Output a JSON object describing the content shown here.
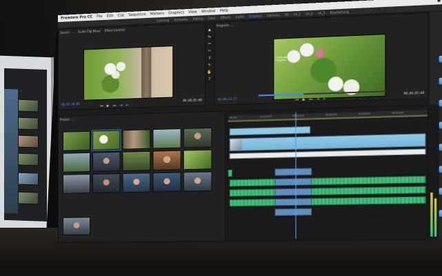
{
  "scene": "photo of an iMac displaying a video editing application",
  "colors": {
    "accent_blue": "#3c8dff",
    "video_clip": "#8fc9e8",
    "audio_clip": "#3fbf7a",
    "selected_audio": "#5f8fc0",
    "ui_dark": "#1d1d1d"
  },
  "menubar": {
    "app_name": "Premiere Pro CC",
    "items": [
      "File",
      "Edit",
      "Clip",
      "Sequence",
      "Markers",
      "Graphics",
      "View",
      "Window",
      "Help"
    ],
    "status": "● ● ● ●"
  },
  "workspaces": {
    "items": [
      "Learning",
      "Assembly",
      "Editing",
      "Color",
      "Effects",
      "Audio",
      "Graphics",
      "Libraries",
      "All",
      "ch_1",
      "ch_2",
      "ch_3",
      "Bearbeitung"
    ],
    "active_index": 6
  },
  "source_monitor": {
    "tabs": [
      "Source: ...",
      "Audio Clip Mixer",
      "Effect Controls"
    ],
    "timecode_in": "00;00;00;00",
    "timecode_out": "00;00;05;00"
  },
  "program_monitor": {
    "tabs": [
      "Program: ..."
    ],
    "timecode_in": "00;00;42;17",
    "timecode_out": "00;00;05;00",
    "overlay_label": "Laufende Projekte"
  },
  "project_panel": {
    "title": "Project: ...",
    "clip_count": 15
  },
  "timeline": {
    "ruler_labels": [
      "00;00",
      "00;02;00",
      "00;04;00",
      "00;06;00",
      "00;08;00",
      "00;10;00"
    ]
  },
  "icons": {
    "transport": [
      "step-back-icon",
      "play-icon",
      "step-forward-icon",
      "insert-icon",
      "overwrite-icon"
    ],
    "tools": [
      "selection-tool-icon",
      "track-select-icon",
      "ripple-edit-icon",
      "razor-icon",
      "slip-icon",
      "pen-icon",
      "hand-icon",
      "type-icon"
    ],
    "apple": "apple-logo-icon"
  },
  "glyphs": {
    "transport": [
      "⏮",
      "▶",
      "⏭",
      "⇥",
      "⇤"
    ],
    "tools": [
      "▲",
      "⇆",
      "↔",
      "✂",
      "↕",
      "✎",
      "✋",
      "T"
    ],
    "apple": ""
  }
}
